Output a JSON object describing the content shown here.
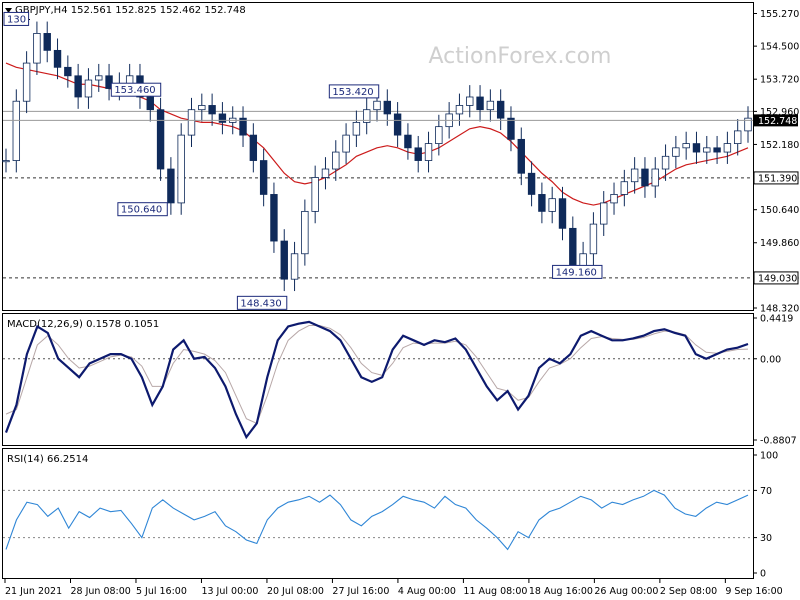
{
  "chart_data": [
    {
      "type": "candlestick",
      "symbol_line": "GBPJPY,H4  152.561 152.825 152.462 152.748",
      "watermark": "ActionForex.com",
      "ylim": [
        148.32,
        155.4
      ],
      "y_ticks": [
        "155.270",
        "154.500",
        "153.720",
        "152.960",
        "152.180",
        "151.390",
        "150.640",
        "149.860",
        "149.030",
        "148.320"
      ],
      "hline_values": [
        152.96,
        151.39,
        149.03
      ],
      "hline_labels": [
        "",
        "151.390",
        "149.030"
      ],
      "current_price": 152.748,
      "current_price_label": "152.748",
      "x_ticks": [
        "21 Jun 2021",
        "28 Jun 08:00",
        "5 Jul 16:00",
        "13 Jul 00:00",
        "20 Jul 08:00",
        "27 Jul 16:00",
        "4 Aug 00:00",
        "11 Aug 08:00",
        "18 Aug 16:00",
        "26 Aug 00:00",
        "2 Sep 08:00",
        "9 Sep 16:00"
      ],
      "x_tick_index": [
        0,
        1,
        2,
        3,
        4,
        5,
        6,
        7,
        8,
        9,
        10,
        11
      ],
      "annotations": [
        {
          "text": "130",
          "at": 0.0,
          "price": 155.13
        },
        {
          "text": "153.460",
          "at": 1.98,
          "price": 153.46
        },
        {
          "text": "150.640",
          "at": 2.08,
          "price": 150.64
        },
        {
          "text": "148.430",
          "at": 3.9,
          "price": 148.43
        },
        {
          "text": "153.420",
          "at": 5.3,
          "price": 153.42
        },
        {
          "text": "149.160",
          "at": 8.7,
          "price": 149.16
        }
      ],
      "close": [
        151.8,
        153.2,
        154.1,
        154.8,
        154.4,
        154.0,
        153.8,
        153.3,
        153.7,
        153.8,
        153.5,
        153.6,
        153.8,
        153.3,
        153.0,
        151.6,
        150.8,
        152.4,
        153.0,
        153.1,
        152.9,
        152.7,
        152.8,
        152.4,
        151.8,
        151.0,
        149.9,
        149.0,
        149.6,
        150.6,
        151.4,
        151.6,
        152.0,
        152.4,
        152.7,
        153.0,
        153.2,
        152.9,
        152.4,
        152.1,
        151.8,
        152.2,
        152.6,
        152.9,
        153.1,
        153.3,
        153.0,
        153.2,
        152.8,
        152.3,
        151.5,
        151.0,
        150.6,
        150.9,
        150.2,
        149.3,
        149.6,
        150.3,
        150.8,
        151.0,
        151.3,
        151.6,
        151.2,
        151.6,
        151.9,
        152.1,
        152.2,
        152.0,
        152.1,
        152.0,
        152.2,
        152.5,
        152.8
      ],
      "ma": [
        154.1,
        154.0,
        153.95,
        153.9,
        153.85,
        153.8,
        153.7,
        153.6,
        153.6,
        153.55,
        153.5,
        153.45,
        153.4,
        153.3,
        153.2,
        153.0,
        152.9,
        152.8,
        152.75,
        152.7,
        152.7,
        152.65,
        152.6,
        152.5,
        152.3,
        152.1,
        151.8,
        151.5,
        151.3,
        151.25,
        151.3,
        151.4,
        151.55,
        151.7,
        151.9,
        152.0,
        152.1,
        152.15,
        152.1,
        152.0,
        151.95,
        152.0,
        152.1,
        152.25,
        152.4,
        152.55,
        152.6,
        152.55,
        152.45,
        152.25,
        152.0,
        151.75,
        151.5,
        151.3,
        151.05,
        150.9,
        150.8,
        150.75,
        150.8,
        150.9,
        151.0,
        151.1,
        151.2,
        151.3,
        151.45,
        151.6,
        151.7,
        151.75,
        151.8,
        151.85,
        151.9,
        152.0,
        152.1
      ]
    },
    {
      "type": "line",
      "title": "MACD(12,26,9) 0.1578 0.1051",
      "ylim": [
        -0.8807,
        0.4419
      ],
      "y_ticks": [
        "0.4419",
        "0.00",
        "-0.8807"
      ],
      "series": [
        {
          "values": [
            -0.8,
            -0.5,
            0.05,
            0.35,
            0.28,
            0.0,
            -0.1,
            -0.2,
            -0.05,
            0.0,
            0.05,
            0.05,
            0.0,
            -0.2,
            -0.5,
            -0.3,
            0.1,
            0.2,
            0.0,
            0.02,
            -0.1,
            -0.3,
            -0.6,
            -0.85,
            -0.7,
            -0.2,
            0.2,
            0.35,
            0.38,
            0.4,
            0.35,
            0.3,
            0.2,
            0.0,
            -0.2,
            -0.25,
            -0.2,
            0.1,
            0.25,
            0.2,
            0.15,
            0.2,
            0.18,
            0.22,
            0.1,
            -0.1,
            -0.3,
            -0.45,
            -0.35,
            -0.55,
            -0.4,
            -0.1,
            0.0,
            -0.05,
            0.05,
            0.25,
            0.3,
            0.25,
            0.2,
            0.2,
            0.22,
            0.25,
            0.3,
            0.32,
            0.28,
            0.25,
            0.05,
            0.0,
            0.05,
            0.1,
            0.12,
            0.16
          ]
        },
        {
          "values": [
            -0.6,
            -0.55,
            -0.2,
            0.15,
            0.25,
            0.15,
            0.0,
            -0.1,
            -0.08,
            -0.03,
            0.02,
            0.04,
            0.02,
            -0.08,
            -0.3,
            -0.3,
            -0.05,
            0.1,
            0.08,
            0.05,
            -0.02,
            -0.15,
            -0.4,
            -0.65,
            -0.7,
            -0.4,
            -0.05,
            0.2,
            0.3,
            0.36,
            0.36,
            0.33,
            0.26,
            0.12,
            -0.05,
            -0.15,
            -0.18,
            -0.05,
            0.12,
            0.17,
            0.16,
            0.17,
            0.17,
            0.19,
            0.15,
            0.02,
            -0.15,
            -0.32,
            -0.35,
            -0.45,
            -0.42,
            -0.25,
            -0.1,
            -0.06,
            0.0,
            0.12,
            0.22,
            0.24,
            0.22,
            0.21,
            0.21,
            0.23,
            0.27,
            0.3,
            0.29,
            0.26,
            0.15,
            0.07,
            0.06,
            0.08,
            0.1,
            0.105
          ]
        }
      ]
    },
    {
      "type": "line",
      "title": "RSI(14) 66.2514",
      "ylim": [
        0,
        100
      ],
      "y_ticks": [
        "100",
        "70",
        "30",
        "0"
      ],
      "levels": [
        70,
        30
      ],
      "series": [
        {
          "values": [
            20,
            45,
            60,
            58,
            48,
            55,
            38,
            52,
            47,
            55,
            52,
            53,
            42,
            30,
            55,
            62,
            55,
            50,
            45,
            48,
            52,
            40,
            35,
            28,
            25,
            45,
            55,
            60,
            62,
            65,
            60,
            66,
            58,
            45,
            40,
            48,
            52,
            58,
            65,
            62,
            60,
            55,
            65,
            58,
            55,
            45,
            38,
            30,
            20,
            35,
            30,
            45,
            52,
            55,
            60,
            65,
            62,
            55,
            60,
            58,
            62,
            65,
            70,
            66,
            55,
            50,
            48,
            55,
            60,
            58,
            62,
            66
          ]
        }
      ]
    }
  ]
}
